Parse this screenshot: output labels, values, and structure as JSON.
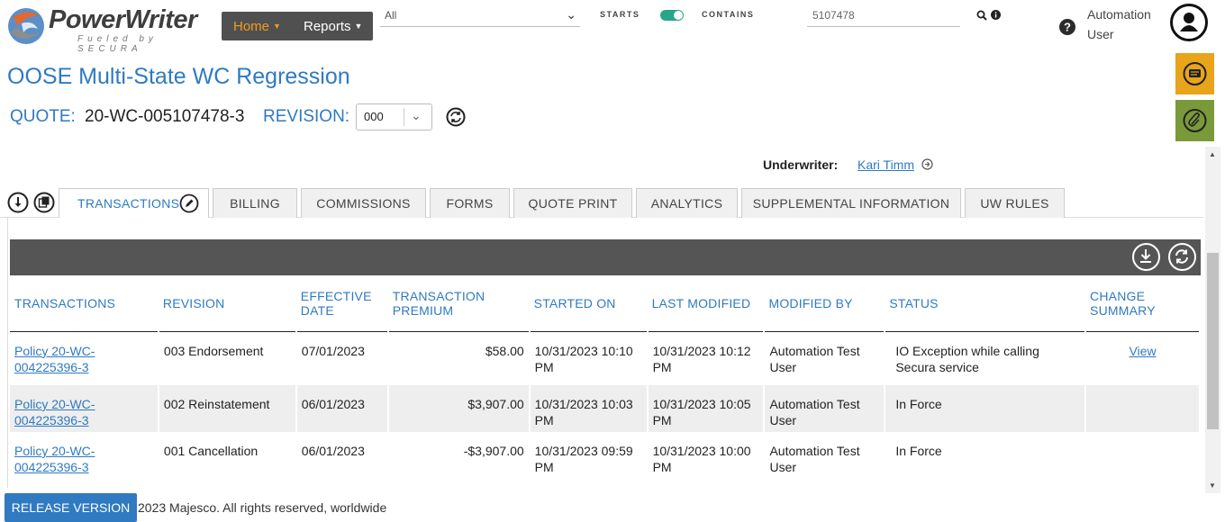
{
  "header": {
    "logo_text": "PowerWriter",
    "logo_subtext": "Fueled by SECURA",
    "nav": [
      {
        "label": "Home"
      },
      {
        "label": "Reports"
      }
    ],
    "scope_select_value": "All",
    "search_mode_left": "STARTS",
    "search_mode_right": "CONTAINS",
    "search_value": "5107478",
    "user_first": "Automation",
    "user_last": "User"
  },
  "page": {
    "title": "OOSE Multi-State WC Regression",
    "quote_label": "QUOTE:",
    "quote_number": "20-WC-005107478-3",
    "revision_label": "REVISION:",
    "revision_value": "000",
    "underwriter_label": "Underwriter:",
    "underwriter_name": "Kari Timm"
  },
  "tabs": [
    {
      "label": "TRANSACTIONS"
    },
    {
      "label": "BILLING"
    },
    {
      "label": "COMMISSIONS"
    },
    {
      "label": "FORMS"
    },
    {
      "label": "QUOTE PRINT"
    },
    {
      "label": "ANALYTICS"
    },
    {
      "label": "SUPPLEMENTAL INFORMATION"
    },
    {
      "label": "UW RULES"
    }
  ],
  "grid": {
    "columns": [
      "TRANSACTIONS",
      "REVISION",
      "EFFECTIVE DATE",
      "TRANSACTION PREMIUM",
      "STARTED ON",
      "LAST MODIFIED",
      "MODIFIED BY",
      "STATUS",
      "CHANGE SUMMARY"
    ],
    "rows": [
      {
        "transaction": "Policy 20-WC-004225396-3",
        "revision": "003 Endorsement",
        "effective": "07/01/2023",
        "premium": "$58.00",
        "started": "10/31/2023 10:10 PM",
        "modified": "10/31/2023 10:12 PM",
        "modified_by": "Automation Test User",
        "status": "IO Exception while calling Secura service",
        "summary": "View"
      },
      {
        "transaction": "Policy 20-WC-004225396-3",
        "revision": "002 Reinstatement",
        "effective": "06/01/2023",
        "premium": "$3,907.00",
        "started": "10/31/2023 10:03 PM",
        "modified": "10/31/2023 10:05 PM",
        "modified_by": "Automation Test User",
        "status": "In Force",
        "summary": ""
      },
      {
        "transaction": "Policy 20-WC-004225396-3",
        "revision": "001 Cancellation",
        "effective": "06/01/2023",
        "premium": "-$3,907.00",
        "started": "10/31/2023 09:59 PM",
        "modified": "10/31/2023 10:00 PM",
        "modified_by": "Automation Test User",
        "status": "In Force",
        "summary": ""
      }
    ]
  },
  "footer": {
    "release_button": "RELEASE VERSION",
    "copyright": "2023 Majesco. All rights reserved, worldwide"
  },
  "colors": {
    "accent_blue": "#2f7ac1",
    "home_orange": "#f29a1f",
    "nav_bg": "#505050",
    "grid_toolbar": "#555555",
    "side_yellow": "#e8a41a",
    "side_green": "#7a9a3a",
    "toggle_green": "#29a58a"
  }
}
